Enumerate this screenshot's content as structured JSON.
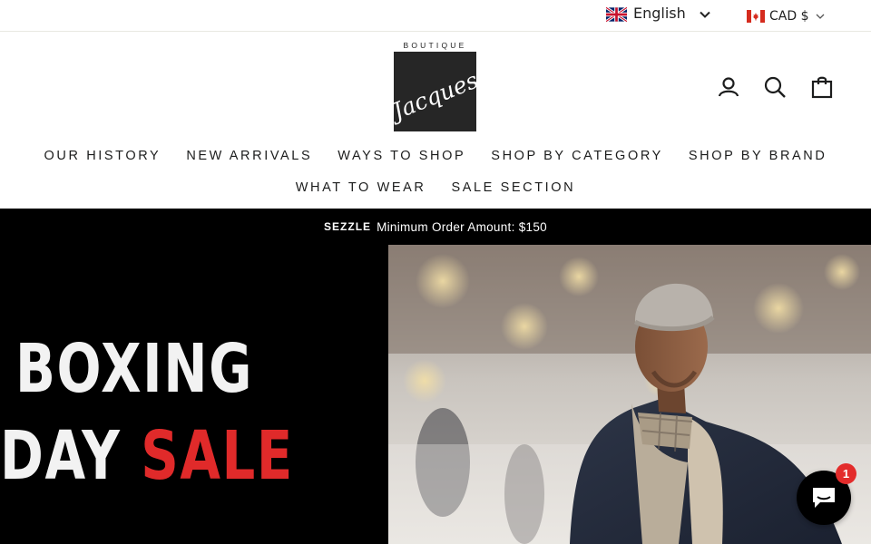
{
  "utility": {
    "language": {
      "label": "English",
      "flag_icon": "uk-flag-icon"
    },
    "currency": {
      "label": "CAD $",
      "flag_icon": "canada-flag-icon"
    }
  },
  "header": {
    "logo": {
      "top_text": "BOUTIQUE",
      "script_text": "Jacques"
    },
    "icons": [
      "user-icon",
      "search-icon",
      "cart-icon"
    ]
  },
  "nav": {
    "row1": [
      "OUR HISTORY",
      "NEW ARRIVALS",
      "WAYS TO SHOP",
      "SHOP BY CATEGORY",
      "SHOP BY BRAND"
    ],
    "row2": [
      "WHAT TO WEAR",
      "SALE SECTION"
    ]
  },
  "announcement": {
    "brand": "SEZZLE",
    "text": "Minimum Order Amount: $150"
  },
  "hero": {
    "line1": "BOXING",
    "line2_white": "DAY ",
    "line2_red": "SALE",
    "colors": {
      "background": "#000000",
      "accent": "#e02a2a",
      "text": "#f2f2f2"
    }
  },
  "chat": {
    "badge_count": "1",
    "icon": "chat-icon"
  }
}
